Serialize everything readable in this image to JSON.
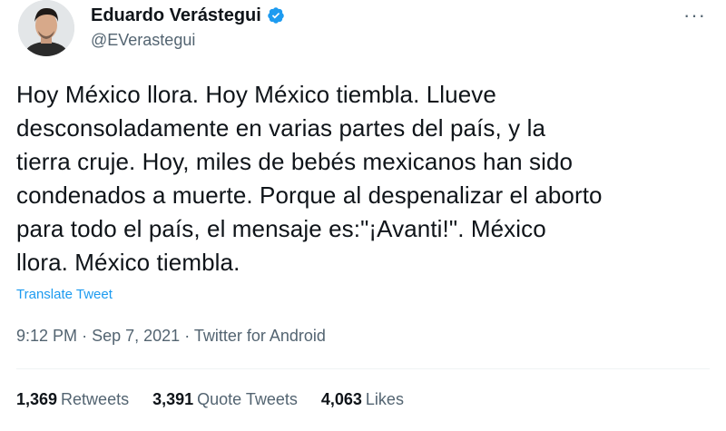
{
  "tweet": {
    "author": {
      "display_name": "Eduardo Verástegui",
      "handle": "@EVerastegui",
      "verified": true
    },
    "more_icon": "ellipsis-icon",
    "lines": [
      "Hoy México llora. Hoy México tiembla. Llueve",
      "desconsoladamente en varias partes del país, y la",
      "tierra cruje. Hoy, miles de bebés mexicanos han sido",
      "condenados a muerte. Porque al despenalizar el aborto",
      "para todo el país, el mensaje es:\"¡Avanti!\". México",
      "llora. México tiembla."
    ],
    "translate_label": "Translate Tweet",
    "time": "9:12 PM",
    "separator": "·",
    "date": "Sep 7, 2021",
    "source": "Twitter for Android",
    "stats": {
      "retweets": {
        "count": "1,369",
        "label": "Retweets"
      },
      "quote_tweets": {
        "count": "3,391",
        "label": "Quote Tweets"
      },
      "likes": {
        "count": "4,063",
        "label": "Likes"
      }
    },
    "colors": {
      "accent": "#1d9bf0",
      "text": "#0f1419",
      "secondary": "#536471"
    }
  }
}
